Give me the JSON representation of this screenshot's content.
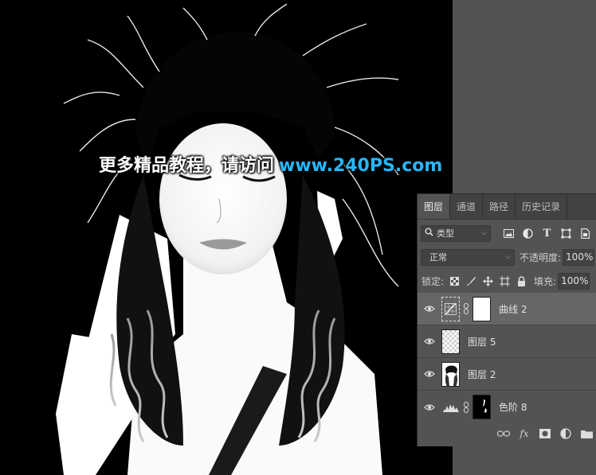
{
  "watermark": {
    "text_cn": "更多精品教程，请访问",
    "url": "www.240PS.com"
  },
  "layers_panel": {
    "tabs": [
      {
        "label": "图层",
        "active": true
      },
      {
        "label": "通道",
        "active": false
      },
      {
        "label": "路径",
        "active": false
      },
      {
        "label": "历史记录",
        "active": false
      }
    ],
    "filter": {
      "search_icon": "search-icon",
      "label": "类型"
    },
    "filter_icons": [
      "image-filter-icon",
      "adjustment-filter-icon",
      "type-filter-icon",
      "shape-filter-icon",
      "smart-object-filter-icon"
    ],
    "blend_mode": "正常",
    "opacity_label": "不透明度:",
    "opacity_value": "100%",
    "lock_label": "锁定:",
    "lock_icons": [
      "lock-transparent-pixels-icon",
      "lock-image-pixels-icon",
      "lock-position-icon",
      "lock-artboard-icon",
      "lock-all-icon"
    ],
    "fill_label": "填充:",
    "fill_value": "100%",
    "layers": [
      {
        "name": "曲线 2",
        "type": "curves",
        "selected": true,
        "visible": true
      },
      {
        "name": "图层 5",
        "type": "pixel-transparent",
        "selected": false,
        "visible": true
      },
      {
        "name": "图层 2",
        "type": "pixel-silhouette",
        "selected": false,
        "visible": true
      },
      {
        "name": "色阶 8",
        "type": "levels",
        "selected": false,
        "visible": true
      }
    ],
    "bottom_icons": [
      "link-layers-icon",
      "fx-icon",
      "add-mask-icon",
      "adjustment-layer-icon",
      "new-group-icon"
    ],
    "fx_label": "fx"
  },
  "colors": {
    "workspace": "#535353",
    "panel_bg": "#535353",
    "tab_bar": "#424242",
    "selected_layer": "#666666",
    "watermark_url": "#29b6f6"
  }
}
